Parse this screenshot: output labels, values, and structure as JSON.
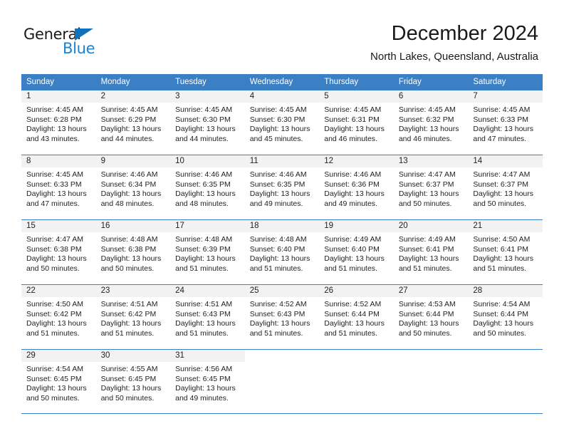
{
  "brand": {
    "name_part1": "General",
    "name_part2": "Blue",
    "accent_color": "#1b84d0",
    "triangle_color": "#1072bb"
  },
  "header": {
    "title": "December 2024",
    "subtitle": "North Lakes, Queensland, Australia"
  },
  "theme": {
    "header_row_bg": "#3b7fc4",
    "daynum_band_bg": "#f2f2f2",
    "grid_line": "#3b7fc4",
    "text": "#222222"
  },
  "weekdays": [
    "Sunday",
    "Monday",
    "Tuesday",
    "Wednesday",
    "Thursday",
    "Friday",
    "Saturday"
  ],
  "weeks": [
    {
      "days": [
        {
          "num": "1",
          "sunrise": "Sunrise: 4:45 AM",
          "sunset": "Sunset: 6:28 PM",
          "daylight1": "Daylight: 13 hours",
          "daylight2": "and 43 minutes."
        },
        {
          "num": "2",
          "sunrise": "Sunrise: 4:45 AM",
          "sunset": "Sunset: 6:29 PM",
          "daylight1": "Daylight: 13 hours",
          "daylight2": "and 44 minutes."
        },
        {
          "num": "3",
          "sunrise": "Sunrise: 4:45 AM",
          "sunset": "Sunset: 6:30 PM",
          "daylight1": "Daylight: 13 hours",
          "daylight2": "and 44 minutes."
        },
        {
          "num": "4",
          "sunrise": "Sunrise: 4:45 AM",
          "sunset": "Sunset: 6:30 PM",
          "daylight1": "Daylight: 13 hours",
          "daylight2": "and 45 minutes."
        },
        {
          "num": "5",
          "sunrise": "Sunrise: 4:45 AM",
          "sunset": "Sunset: 6:31 PM",
          "daylight1": "Daylight: 13 hours",
          "daylight2": "and 46 minutes."
        },
        {
          "num": "6",
          "sunrise": "Sunrise: 4:45 AM",
          "sunset": "Sunset: 6:32 PM",
          "daylight1": "Daylight: 13 hours",
          "daylight2": "and 46 minutes."
        },
        {
          "num": "7",
          "sunrise": "Sunrise: 4:45 AM",
          "sunset": "Sunset: 6:33 PM",
          "daylight1": "Daylight: 13 hours",
          "daylight2": "and 47 minutes."
        }
      ]
    },
    {
      "days": [
        {
          "num": "8",
          "sunrise": "Sunrise: 4:45 AM",
          "sunset": "Sunset: 6:33 PM",
          "daylight1": "Daylight: 13 hours",
          "daylight2": "and 47 minutes."
        },
        {
          "num": "9",
          "sunrise": "Sunrise: 4:46 AM",
          "sunset": "Sunset: 6:34 PM",
          "daylight1": "Daylight: 13 hours",
          "daylight2": "and 48 minutes."
        },
        {
          "num": "10",
          "sunrise": "Sunrise: 4:46 AM",
          "sunset": "Sunset: 6:35 PM",
          "daylight1": "Daylight: 13 hours",
          "daylight2": "and 48 minutes."
        },
        {
          "num": "11",
          "sunrise": "Sunrise: 4:46 AM",
          "sunset": "Sunset: 6:35 PM",
          "daylight1": "Daylight: 13 hours",
          "daylight2": "and 49 minutes."
        },
        {
          "num": "12",
          "sunrise": "Sunrise: 4:46 AM",
          "sunset": "Sunset: 6:36 PM",
          "daylight1": "Daylight: 13 hours",
          "daylight2": "and 49 minutes."
        },
        {
          "num": "13",
          "sunrise": "Sunrise: 4:47 AM",
          "sunset": "Sunset: 6:37 PM",
          "daylight1": "Daylight: 13 hours",
          "daylight2": "and 50 minutes."
        },
        {
          "num": "14",
          "sunrise": "Sunrise: 4:47 AM",
          "sunset": "Sunset: 6:37 PM",
          "daylight1": "Daylight: 13 hours",
          "daylight2": "and 50 minutes."
        }
      ]
    },
    {
      "days": [
        {
          "num": "15",
          "sunrise": "Sunrise: 4:47 AM",
          "sunset": "Sunset: 6:38 PM",
          "daylight1": "Daylight: 13 hours",
          "daylight2": "and 50 minutes."
        },
        {
          "num": "16",
          "sunrise": "Sunrise: 4:48 AM",
          "sunset": "Sunset: 6:38 PM",
          "daylight1": "Daylight: 13 hours",
          "daylight2": "and 50 minutes."
        },
        {
          "num": "17",
          "sunrise": "Sunrise: 4:48 AM",
          "sunset": "Sunset: 6:39 PM",
          "daylight1": "Daylight: 13 hours",
          "daylight2": "and 51 minutes."
        },
        {
          "num": "18",
          "sunrise": "Sunrise: 4:48 AM",
          "sunset": "Sunset: 6:40 PM",
          "daylight1": "Daylight: 13 hours",
          "daylight2": "and 51 minutes."
        },
        {
          "num": "19",
          "sunrise": "Sunrise: 4:49 AM",
          "sunset": "Sunset: 6:40 PM",
          "daylight1": "Daylight: 13 hours",
          "daylight2": "and 51 minutes."
        },
        {
          "num": "20",
          "sunrise": "Sunrise: 4:49 AM",
          "sunset": "Sunset: 6:41 PM",
          "daylight1": "Daylight: 13 hours",
          "daylight2": "and 51 minutes."
        },
        {
          "num": "21",
          "sunrise": "Sunrise: 4:50 AM",
          "sunset": "Sunset: 6:41 PM",
          "daylight1": "Daylight: 13 hours",
          "daylight2": "and 51 minutes."
        }
      ]
    },
    {
      "days": [
        {
          "num": "22",
          "sunrise": "Sunrise: 4:50 AM",
          "sunset": "Sunset: 6:42 PM",
          "daylight1": "Daylight: 13 hours",
          "daylight2": "and 51 minutes."
        },
        {
          "num": "23",
          "sunrise": "Sunrise: 4:51 AM",
          "sunset": "Sunset: 6:42 PM",
          "daylight1": "Daylight: 13 hours",
          "daylight2": "and 51 minutes."
        },
        {
          "num": "24",
          "sunrise": "Sunrise: 4:51 AM",
          "sunset": "Sunset: 6:43 PM",
          "daylight1": "Daylight: 13 hours",
          "daylight2": "and 51 minutes."
        },
        {
          "num": "25",
          "sunrise": "Sunrise: 4:52 AM",
          "sunset": "Sunset: 6:43 PM",
          "daylight1": "Daylight: 13 hours",
          "daylight2": "and 51 minutes."
        },
        {
          "num": "26",
          "sunrise": "Sunrise: 4:52 AM",
          "sunset": "Sunset: 6:44 PM",
          "daylight1": "Daylight: 13 hours",
          "daylight2": "and 51 minutes."
        },
        {
          "num": "27",
          "sunrise": "Sunrise: 4:53 AM",
          "sunset": "Sunset: 6:44 PM",
          "daylight1": "Daylight: 13 hours",
          "daylight2": "and 50 minutes."
        },
        {
          "num": "28",
          "sunrise": "Sunrise: 4:54 AM",
          "sunset": "Sunset: 6:44 PM",
          "daylight1": "Daylight: 13 hours",
          "daylight2": "and 50 minutes."
        }
      ]
    },
    {
      "days": [
        {
          "num": "29",
          "sunrise": "Sunrise: 4:54 AM",
          "sunset": "Sunset: 6:45 PM",
          "daylight1": "Daylight: 13 hours",
          "daylight2": "and 50 minutes."
        },
        {
          "num": "30",
          "sunrise": "Sunrise: 4:55 AM",
          "sunset": "Sunset: 6:45 PM",
          "daylight1": "Daylight: 13 hours",
          "daylight2": "and 50 minutes."
        },
        {
          "num": "31",
          "sunrise": "Sunrise: 4:56 AM",
          "sunset": "Sunset: 6:45 PM",
          "daylight1": "Daylight: 13 hours",
          "daylight2": "and 49 minutes."
        },
        {
          "num": "",
          "sunrise": "",
          "sunset": "",
          "daylight1": "",
          "daylight2": ""
        },
        {
          "num": "",
          "sunrise": "",
          "sunset": "",
          "daylight1": "",
          "daylight2": ""
        },
        {
          "num": "",
          "sunrise": "",
          "sunset": "",
          "daylight1": "",
          "daylight2": ""
        },
        {
          "num": "",
          "sunrise": "",
          "sunset": "",
          "daylight1": "",
          "daylight2": ""
        }
      ]
    }
  ]
}
